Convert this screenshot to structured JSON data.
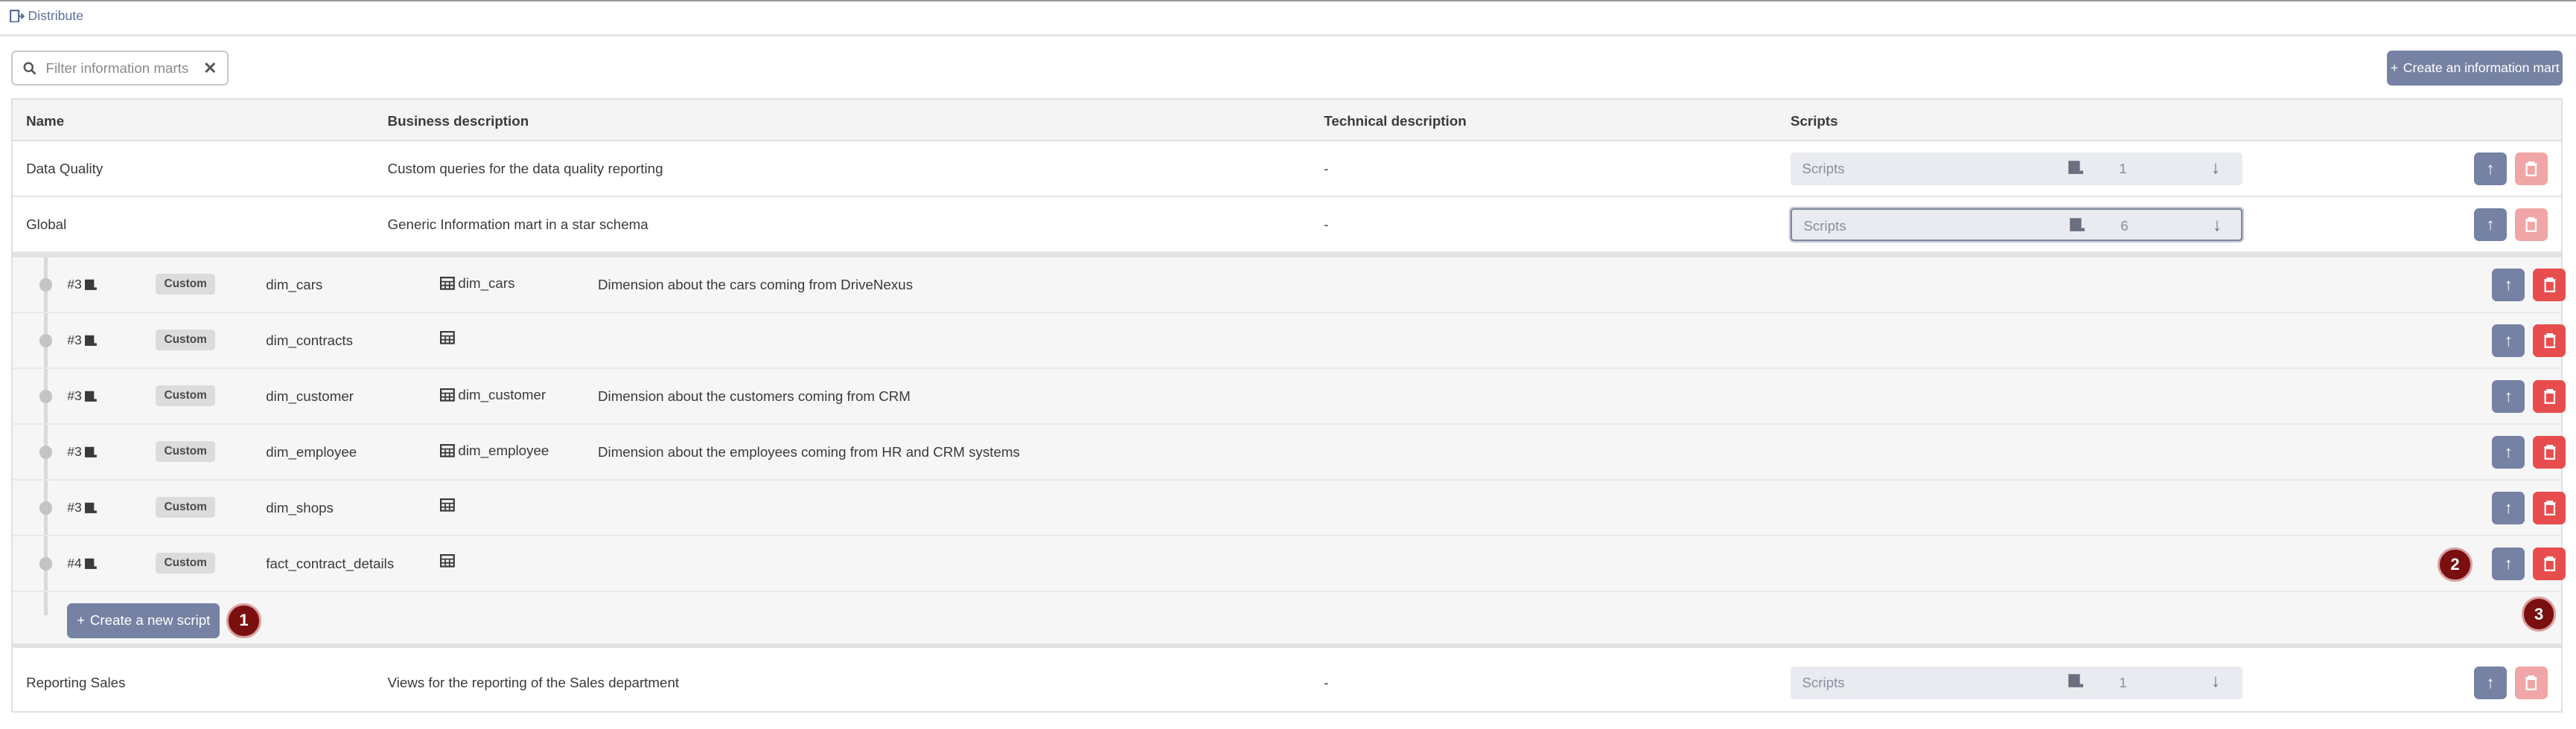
{
  "breadcrumb": {
    "label": "Distribute",
    "icon": "distribute-icon"
  },
  "filter": {
    "placeholder": "Filter information marts",
    "clear": "✕"
  },
  "create_mart_button": "Create an information mart",
  "columns": {
    "name": "Name",
    "business": "Business description",
    "technical": "Technical description",
    "scripts": "Scripts"
  },
  "marts": [
    {
      "name": "Data Quality",
      "business": "Custom queries for the data quality reporting",
      "technical": "-",
      "scripts_label": "Scripts",
      "scripts_count": "1"
    },
    {
      "name": "Global",
      "business": "Generic Information mart in a star schema",
      "technical": "-",
      "scripts_label": "Scripts",
      "scripts_count": "6"
    },
    {
      "name": "Reporting Sales",
      "business": "Views for the reporting of the Sales department",
      "technical": "-",
      "scripts_label": "Scripts",
      "scripts_count": "1"
    }
  ],
  "scripts": [
    {
      "num": "#3",
      "type": "Custom",
      "name": "dim_cars",
      "table": "dim_cars",
      "description": "Dimension about the cars coming from DriveNexus"
    },
    {
      "num": "#3",
      "type": "Custom",
      "name": "dim_contracts",
      "table": "",
      "description": ""
    },
    {
      "num": "#3",
      "type": "Custom",
      "name": "dim_customer",
      "table": "dim_customer",
      "description": "Dimension about the customers coming from CRM"
    },
    {
      "num": "#3",
      "type": "Custom",
      "name": "dim_employee",
      "table": "dim_employee",
      "description": "Dimension about the employees coming from HR and CRM systems"
    },
    {
      "num": "#3",
      "type": "Custom",
      "name": "dim_shops",
      "table": "",
      "description": ""
    },
    {
      "num": "#4",
      "type": "Custom",
      "name": "fact_contract_details",
      "table": "",
      "description": ""
    }
  ],
  "create_script_button": "Create a new script",
  "markers": {
    "one": "1",
    "two": "2",
    "three": "3"
  },
  "colors": {
    "primary": "#7582a4",
    "danger": "#e84d4d",
    "marker": "#7a0f0f"
  }
}
